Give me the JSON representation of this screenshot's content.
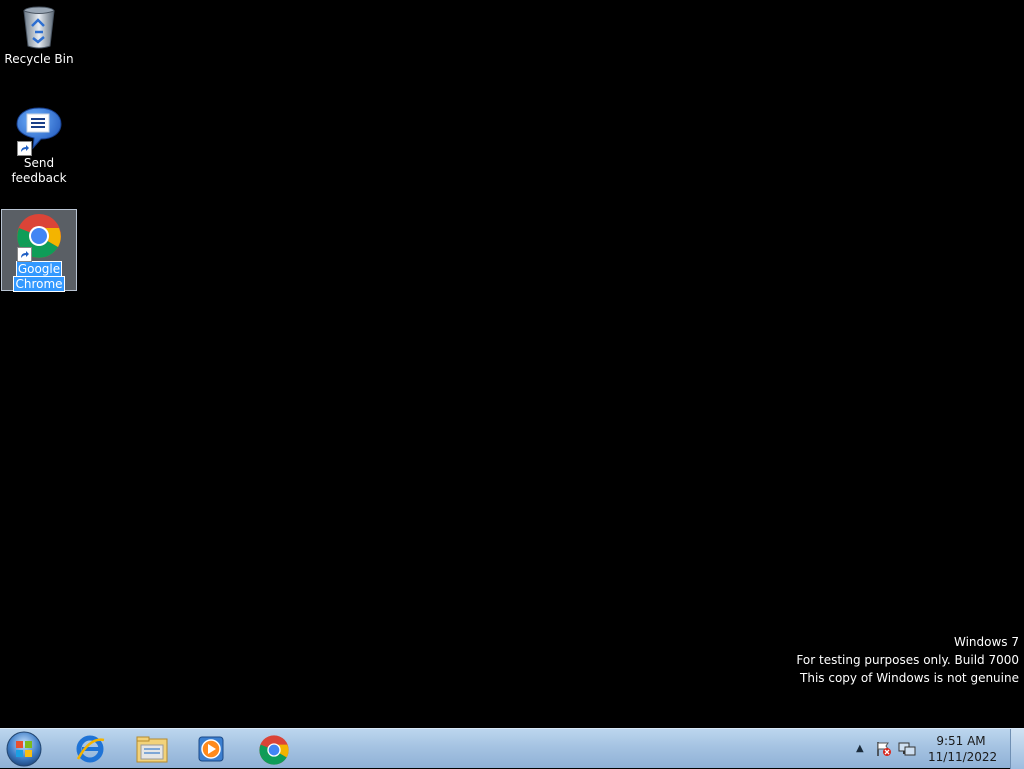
{
  "desktop": {
    "icons": [
      {
        "label": "Recycle Bin",
        "icon": "recycle-bin-icon"
      },
      {
        "label_line1": "Send",
        "label_line2": "feedback",
        "icon": "send-feedback-icon"
      },
      {
        "label_line1": "Google",
        "label_line2": "Chrome",
        "icon": "google-chrome-icon",
        "selected": true
      }
    ]
  },
  "watermark": {
    "line1": "Windows  7",
    "line2": "For testing purposes only. Build 7000",
    "line3": "This copy of Windows is not genuine"
  },
  "taskbar": {
    "pinned": [
      {
        "icon": "internet-explorer-icon"
      },
      {
        "icon": "windows-explorer-icon"
      },
      {
        "icon": "media-player-icon"
      },
      {
        "icon": "google-chrome-icon"
      }
    ],
    "tray": {
      "time": "9:51 AM",
      "date": "11/11/2022"
    }
  },
  "colors": {
    "selection": "#3399ff",
    "taskbar_top": "#bcd6ee",
    "taskbar_bottom": "#8fb1d6"
  }
}
